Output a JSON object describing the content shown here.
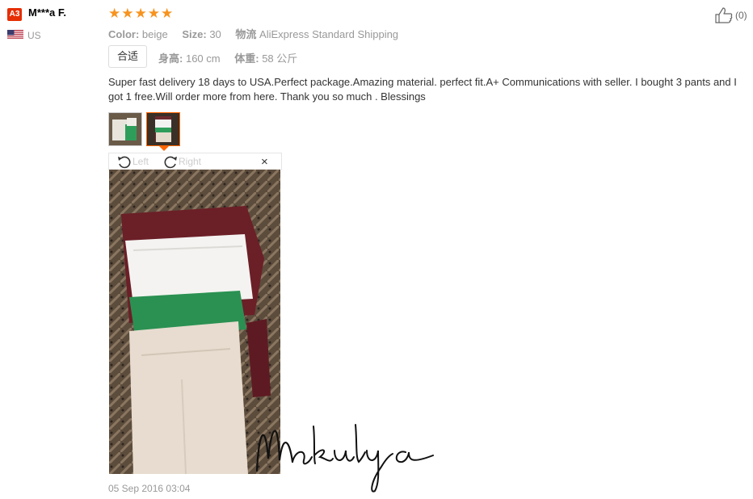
{
  "reviewer": {
    "level": "A3",
    "name": "M***a F.",
    "country": "US",
    "flag_icon": "us-flag-icon"
  },
  "review": {
    "rating": 5,
    "rating_max": 5,
    "star_color": "#f7931e",
    "color_label": "Color:",
    "color_value": "beige",
    "size_label": "Size:",
    "size_value": "30",
    "shipping_label": "物流",
    "shipping_value": "AliExpress Standard Shipping",
    "fit_tag": "合适",
    "height_label": "身高:",
    "height_value": "160 cm",
    "weight_label": "体重:",
    "weight_value": "58 公斤",
    "text": "Super fast delivery 18 days to USA.Perfect package.Amazing material. perfect fit.A+ Communications with seller. I bought 3 pants and I got 1 free.Will order more from here. Thank you so much . Blessings",
    "date": "05 Sep 2016 03:04"
  },
  "helpful": {
    "icon": "thumbs-up-icon",
    "count": "(0)"
  },
  "viewer": {
    "rotate_left_label": "Left",
    "rotate_right_label": "Right",
    "close_label": "×",
    "selected_thumb": 2
  },
  "watermark": {
    "text": "Makuluya"
  },
  "colors": {
    "badge": "#e62e04",
    "accent": "#ff6600",
    "muted": "#999999"
  }
}
